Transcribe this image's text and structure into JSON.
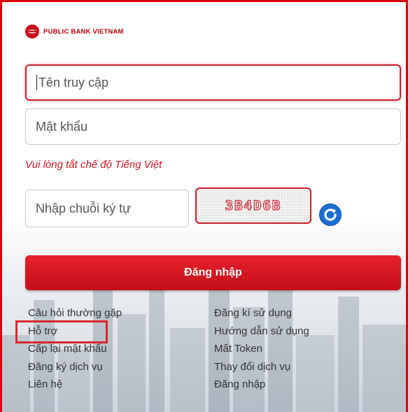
{
  "brand": {
    "name": "PUBLIC BANK VIETNAM",
    "logo_icon": "public-bank-logo-icon",
    "color": "#c8101a"
  },
  "form": {
    "username_placeholder": "Tên truy cập",
    "password_placeholder": "Mật khẩu",
    "notice": "Vui lòng tắt chế độ Tiếng Việt",
    "captcha_placeholder": "Nhập chuỗi ký tự",
    "captcha_code": "3B4D6B",
    "refresh_icon": "refresh-icon",
    "login_label": "Đăng nhập"
  },
  "links": {
    "left": [
      "Câu hỏi thường gặp",
      "Hỗ trợ",
      "Cấp lại mật khẩu",
      "Đăng ký dịch vụ",
      "Liên hệ"
    ],
    "right": [
      "Đăng kí sử dụng",
      "Hướng dẫn sử dụng",
      "Mất Token",
      "Thay đổi dịch vụ",
      "Đăng nhập"
    ]
  },
  "colors": {
    "accent": "#d9000f",
    "button": "#d0141f",
    "refresh": "#1c6fd1"
  }
}
